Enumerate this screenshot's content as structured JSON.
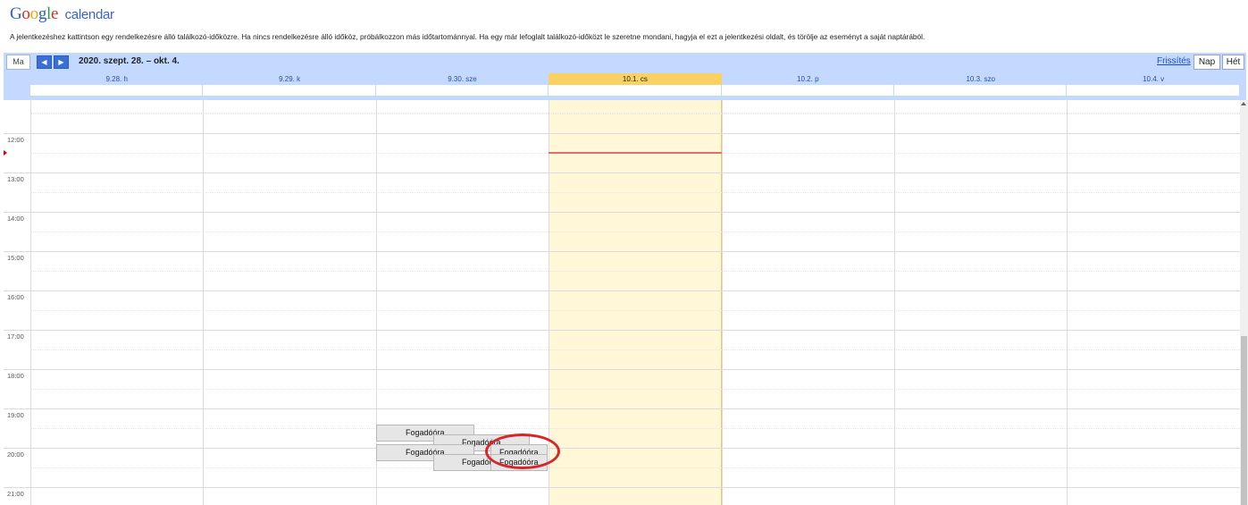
{
  "header": {
    "logo_letters": [
      "G",
      "o",
      "o",
      "g",
      "l",
      "e"
    ],
    "logo_sub": "calendar",
    "instruction": "A jelentkezéshez kattintson egy rendelkezésre álló találkozó-időközre. Ha nincs rendelkezésre álló időköz, próbálkozzon más időtartománnyal. Ha egy már lefoglalt találkozó-időközt le szeretne mondani, hagyja el ezt a jelentkezési oldalt, és törölje az eseményt a saját naptárából."
  },
  "toolbar": {
    "today_label": "Ma",
    "prev_icon": "◀",
    "next_icon": "▶",
    "date_range": "2020. szept. 28. – okt. 4.",
    "refresh_label": "Frissítés",
    "day_view_label": "Nap",
    "week_view_label": "Hét"
  },
  "days": [
    {
      "label": "9.28. h",
      "today": false
    },
    {
      "label": "9.29. k",
      "today": false
    },
    {
      "label": "9.30. sze",
      "today": false
    },
    {
      "label": "10.1. cs",
      "today": true
    },
    {
      "label": "10.2. p",
      "today": false
    },
    {
      "label": "10.3. szo",
      "today": false
    },
    {
      "label": "10.4. v",
      "today": false
    }
  ],
  "time_labels": [
    "12:00",
    "13:00",
    "14:00",
    "15:00",
    "16:00",
    "17:00",
    "18:00",
    "19:00",
    "20:00",
    "21:00"
  ],
  "now_time": "12:30",
  "events": [
    {
      "label": "Fogadóóra",
      "day": 2,
      "start": "19:30",
      "column": 0
    },
    {
      "label": "Fogadóóra",
      "day": 2,
      "start": "19:45",
      "column": 1
    },
    {
      "label": "Fogadóóra",
      "day": 2,
      "start": "20:00",
      "column": 2
    },
    {
      "label": "Fogadóóra",
      "day": 2,
      "start": "20:00",
      "column": 0
    },
    {
      "label": "Fogadóóra",
      "day": 2,
      "start": "20:15",
      "column": 1
    },
    {
      "label": "Fogadóóra",
      "day": 2,
      "start": "20:15",
      "column": 2
    }
  ],
  "highlighted_event_index": 2,
  "colors": {
    "header_bar": "#c3d9ff",
    "today_header": "#fad163",
    "today_column": "#fff7d7",
    "now_line": "#e07070",
    "highlight_ring": "#d8242b"
  }
}
